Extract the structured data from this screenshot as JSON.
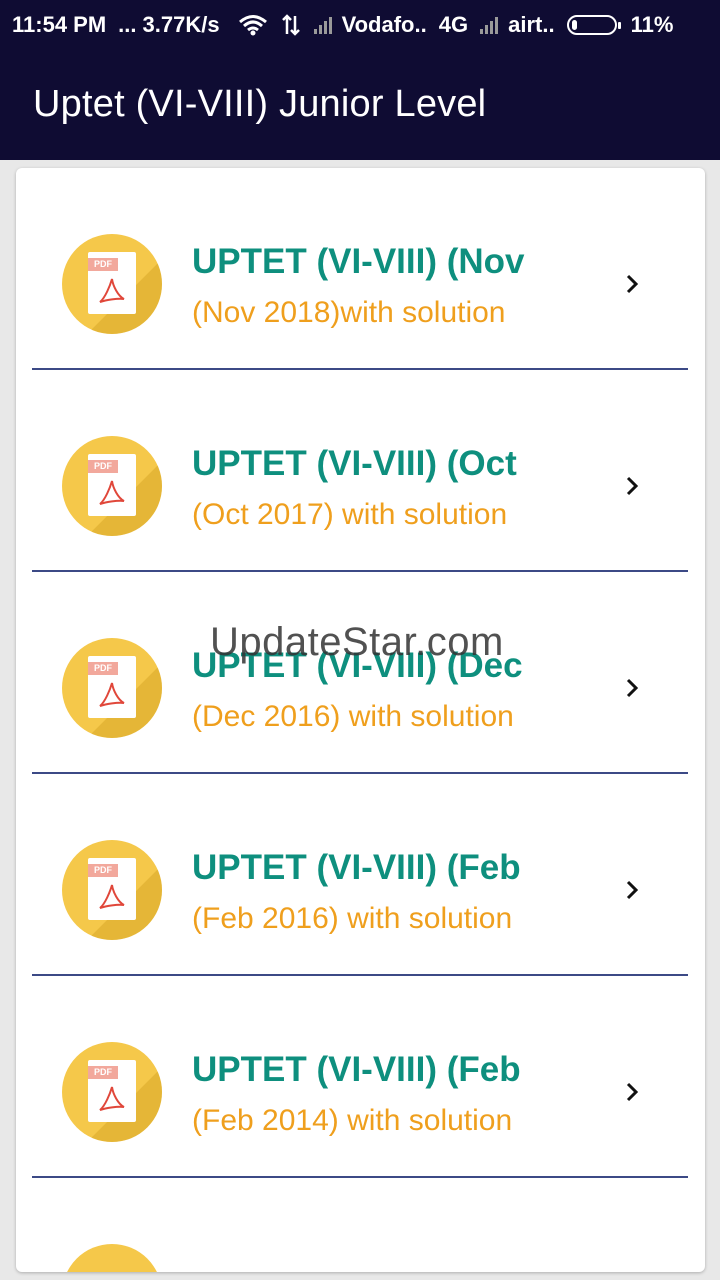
{
  "status_bar": {
    "time": "11:54 PM",
    "dots": "...",
    "speed": "3.77K/s",
    "carrier1": "Vodafo..",
    "network1": "4G",
    "carrier2": "airt..",
    "battery": "11%"
  },
  "app_bar": {
    "title": "Uptet (VI-VIII) Junior Level"
  },
  "list": [
    {
      "title": "UPTET (VI-VIII) (Nov",
      "subtitle": "(Nov 2018)with solution"
    },
    {
      "title": "UPTET (VI-VIII) (Oct",
      "subtitle": "(Oct 2017) with solution"
    },
    {
      "title": "UPTET (VI-VIII) (Dec",
      "subtitle": "(Dec 2016) with solution"
    },
    {
      "title": "UPTET (VI-VIII) (Feb",
      "subtitle": "(Feb 2016) with solution"
    },
    {
      "title": "UPTET (VI-VIII) (Feb",
      "subtitle": "(Feb 2014) with solution"
    }
  ],
  "watermark": "UpdateStar.com",
  "icons": {
    "pdf": "pdf-file-icon",
    "chevron": "chevron-right-icon",
    "wifi": "wifi-icon",
    "data": "data-transfer-icon",
    "signal": "signal-icon",
    "battery": "battery-icon"
  },
  "colors": {
    "app_bar": "#0f0c33",
    "title": "#0e8f7e",
    "subtitle": "#ef9f1d",
    "divider": "#3c4a86",
    "icon_circle": "#f5c84a"
  }
}
